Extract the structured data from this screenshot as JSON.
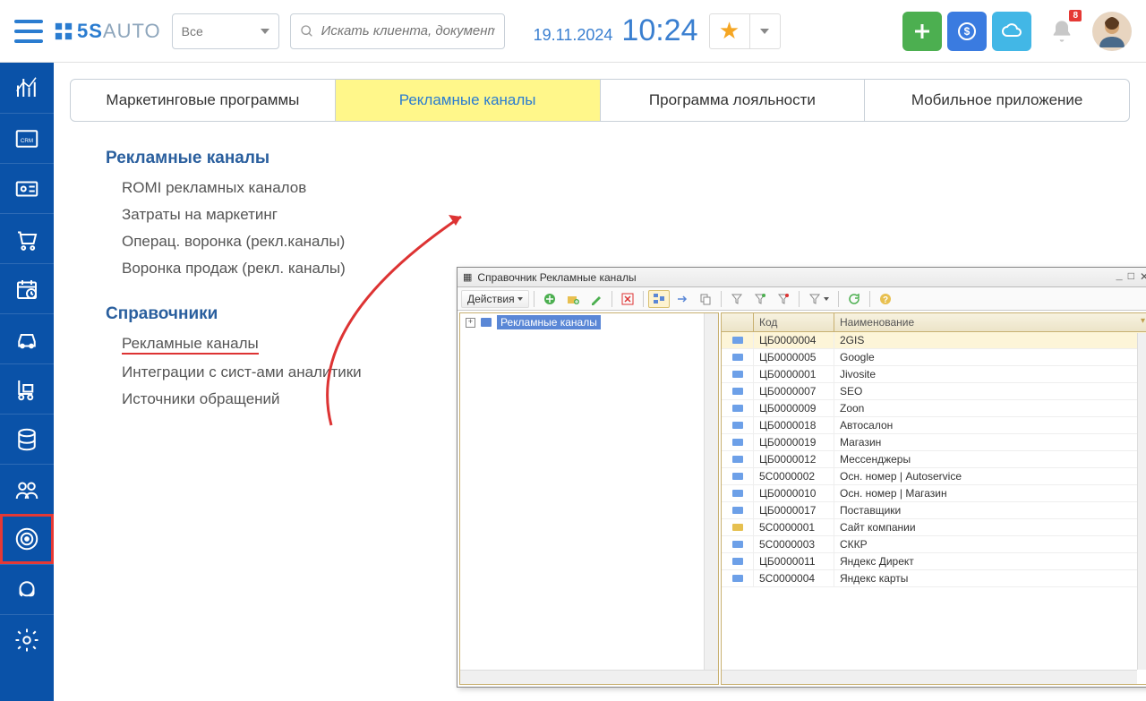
{
  "header": {
    "logo": {
      "brand": "5S",
      "suffix": "AUTO"
    },
    "filter": "Все",
    "search_placeholder": "Искать клиента, документ",
    "date": "19.11.2024",
    "time": "10:24",
    "badge_count": "8"
  },
  "tabs": [
    "Маркетинговые программы",
    "Рекламные каналы",
    "Программа лояльности",
    "Мобильное приложение"
  ],
  "active_tab": 1,
  "sections": [
    {
      "title": "Рекламные каналы",
      "links": [
        {
          "label": "ROMI рекламных каналов",
          "hl": false
        },
        {
          "label": "Затраты на маркетинг",
          "hl": false
        },
        {
          "label": "Операц. воронка (рекл.каналы)",
          "hl": false
        },
        {
          "label": "Воронка продаж (рекл. каналы)",
          "hl": false
        }
      ]
    },
    {
      "title": "Справочники",
      "links": [
        {
          "label": "Рекламные каналы",
          "hl": true
        },
        {
          "label": "Интеграции с сист-ами аналитики",
          "hl": false
        },
        {
          "label": "Источники обращений",
          "hl": false
        }
      ]
    }
  ],
  "popup": {
    "title": "Справочник Рекламные каналы",
    "actions_label": "Действия",
    "tree_root": "Рекламные каналы",
    "columns": [
      "",
      "Код",
      "Наименование"
    ],
    "rows": [
      {
        "code": "ЦБ0000004",
        "name": "2GIS",
        "gold": false
      },
      {
        "code": "ЦБ0000005",
        "name": "Google",
        "gold": false
      },
      {
        "code": "ЦБ0000001",
        "name": "Jivosite",
        "gold": false
      },
      {
        "code": "ЦБ0000007",
        "name": "SEO",
        "gold": false
      },
      {
        "code": "ЦБ0000009",
        "name": "Zoon",
        "gold": false
      },
      {
        "code": "ЦБ0000018",
        "name": "Автосалон",
        "gold": false
      },
      {
        "code": "ЦБ0000019",
        "name": "Магазин",
        "gold": false
      },
      {
        "code": "ЦБ0000012",
        "name": "Мессенджеры",
        "gold": false
      },
      {
        "code": "5С0000002",
        "name": "Осн. номер | Autoservice",
        "gold": false
      },
      {
        "code": "ЦБ0000010",
        "name": "Осн. номер | Магазин",
        "gold": false
      },
      {
        "code": "ЦБ0000017",
        "name": "Поставщики",
        "gold": false
      },
      {
        "code": "5С0000001",
        "name": "Сайт компании",
        "gold": true
      },
      {
        "code": "5С0000003",
        "name": "СККР",
        "gold": false
      },
      {
        "code": "ЦБ0000011",
        "name": "Яндекс Директ",
        "gold": false
      },
      {
        "code": "5С0000004",
        "name": "Яндекс карты",
        "gold": false
      }
    ]
  }
}
